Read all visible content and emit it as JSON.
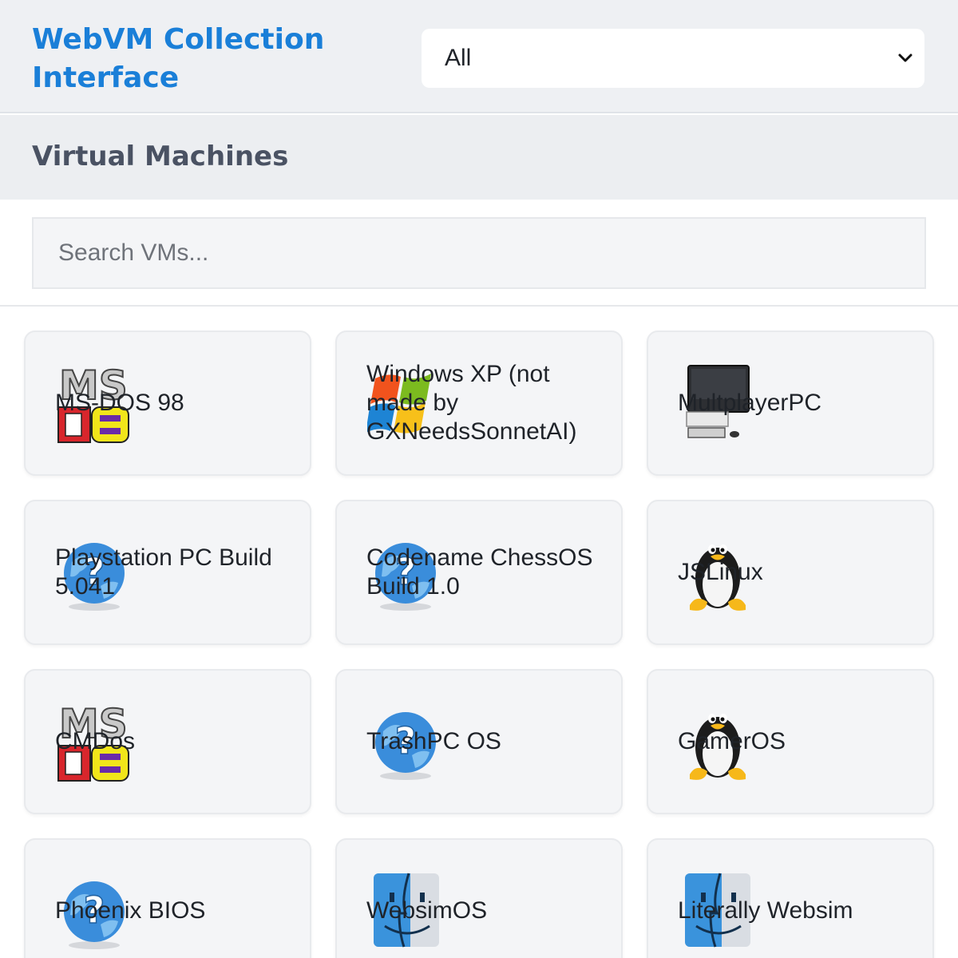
{
  "header": {
    "title": "WebVM Collection Interface",
    "filter": {
      "selected": "All"
    }
  },
  "section": {
    "title": "Virtual Machines"
  },
  "search": {
    "placeholder": "Search VMs..."
  },
  "vms": [
    {
      "label": "MS-DOS 98",
      "icon": "msdos-logo-icon"
    },
    {
      "label": "Windows XP (not made by GXNeedsSonnetAI)",
      "icon": "windows-xp-logo-icon"
    },
    {
      "label": "MultplayerPC",
      "icon": "desktop-computer-icon"
    },
    {
      "label": "Playstation PC Build 5.041",
      "icon": "unknown-globe-icon"
    },
    {
      "label": "Codename ChessOS Build 1.0",
      "icon": "unknown-globe-icon"
    },
    {
      "label": "JSLinux",
      "icon": "tux-penguin-icon"
    },
    {
      "label": "CMDos",
      "icon": "msdos-logo-icon"
    },
    {
      "label": "TrashPC OS",
      "icon": "unknown-globe-icon"
    },
    {
      "label": "GamerOS",
      "icon": "tux-penguin-icon"
    },
    {
      "label": "Phoenix BIOS",
      "icon": "unknown-globe-icon"
    },
    {
      "label": "WebsimOS",
      "icon": "mac-finder-icon"
    },
    {
      "label": "Literally Websim",
      "icon": "mac-finder-icon"
    }
  ]
}
